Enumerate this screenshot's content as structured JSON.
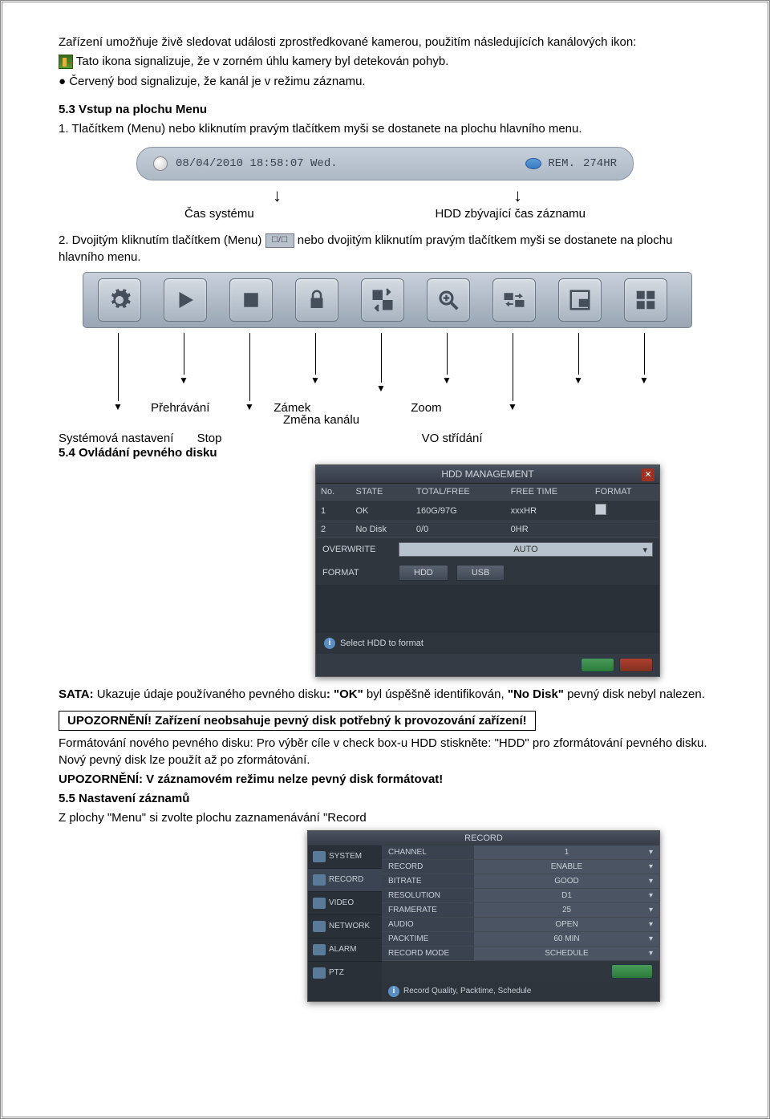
{
  "intro_text": "Zařízení umožňuje živě sledovat události zprostředkované kamerou, použitím následujících kanálových ikon:",
  "icon_desc": "Tato ikona signalizuje, že v zorném úhlu kamery byl detekován pohyb.",
  "red_dot_desc": "● Červený bod signalizuje, že kanál je v režimu záznamu.",
  "section_53": "5.3 Vstup na plochu Menu",
  "step1": "1. Tlačítkem (Menu) nebo kliknutím pravým tlačítkem myši se dostanete na plochu hlavního menu.",
  "statusbar": {
    "datetime": "08/04/2010 18:58:07 Wed.",
    "rem_label": "REM.",
    "rem_value": "274HR"
  },
  "labels": {
    "time": "Čas systému",
    "hdd": "HDD zbývající čas záznamu"
  },
  "step2_a": "2. Dvojitým kliknutím tlačítkem (Menu) ",
  "step2_b": " nebo dvojitým kliknutím pravým tlačítkem myši se dostanete na plochu hlavního menu.",
  "toolbar_labels": {
    "play": "Přehrávání",
    "lock": "Zámek",
    "zoom": "Zoom",
    "channel": "Změna kanálu",
    "system": "Systémová nastavení",
    "stop": "Stop",
    "vo": "VO střídání"
  },
  "section_54": "5.4 Ovládání pevného disku",
  "hdd": {
    "title": "HDD MANAGEMENT",
    "headers": [
      "No.",
      "STATE",
      "TOTAL/FREE",
      "FREE TIME",
      "FORMAT"
    ],
    "rows": [
      [
        "1",
        "OK",
        "160G/97G",
        "xxxHR",
        ""
      ],
      [
        "2",
        "No Disk",
        "0/0",
        "0HR",
        ""
      ]
    ],
    "overwrite_label": "OVERWRITE",
    "overwrite_value": "AUTO",
    "format_label": "FORMAT",
    "format_hdd": "HDD",
    "format_usb": "USB",
    "footer_text": "Select HDD to format"
  },
  "sata_text": "SATA: Ukazuje údaje používaného pevného disku: \"OK\" byl úspěšně identifikován, \"No Disk\" pevný disk nebyl nalezen.",
  "sata_label": "SATA:",
  "warning_box": "UPOZORNĚNÍ! Zařízení neobsahuje pevný disk potřebný k provozování zařízení!",
  "format_text": "Formátování nového pevného disku: Pro výběr cíle v check box-u HDD stiskněte: \"HDD\" pro zformátování pevného disku. Nový pevný disk lze použít až po zformátování.",
  "warning2": "UPOZORNĚNÍ: V záznamovém režimu nelze pevný disk formátovat!",
  "section_55": "5.5 Nastavení záznamů",
  "section_55_desc": "Z plochy \"Menu\" si zvolte plochu zaznamenávání \"Record",
  "record": {
    "title": "RECORD",
    "sidebar": [
      "SYSTEM",
      "RECORD",
      "VIDEO",
      "NETWORK",
      "ALARM",
      "PTZ"
    ],
    "rows": [
      [
        "CHANNEL",
        "1"
      ],
      [
        "RECORD",
        "ENABLE"
      ],
      [
        "BITRATE",
        "GOOD"
      ],
      [
        "RESOLUTION",
        "D1"
      ],
      [
        "FRAMERATE",
        "25"
      ],
      [
        "AUDIO",
        "OPEN"
      ],
      [
        "PACKTIME",
        "60 MIN"
      ],
      [
        "RECORD MODE",
        "SCHEDULE"
      ]
    ],
    "footer": "Record Quality, Packtime, Schedule"
  }
}
